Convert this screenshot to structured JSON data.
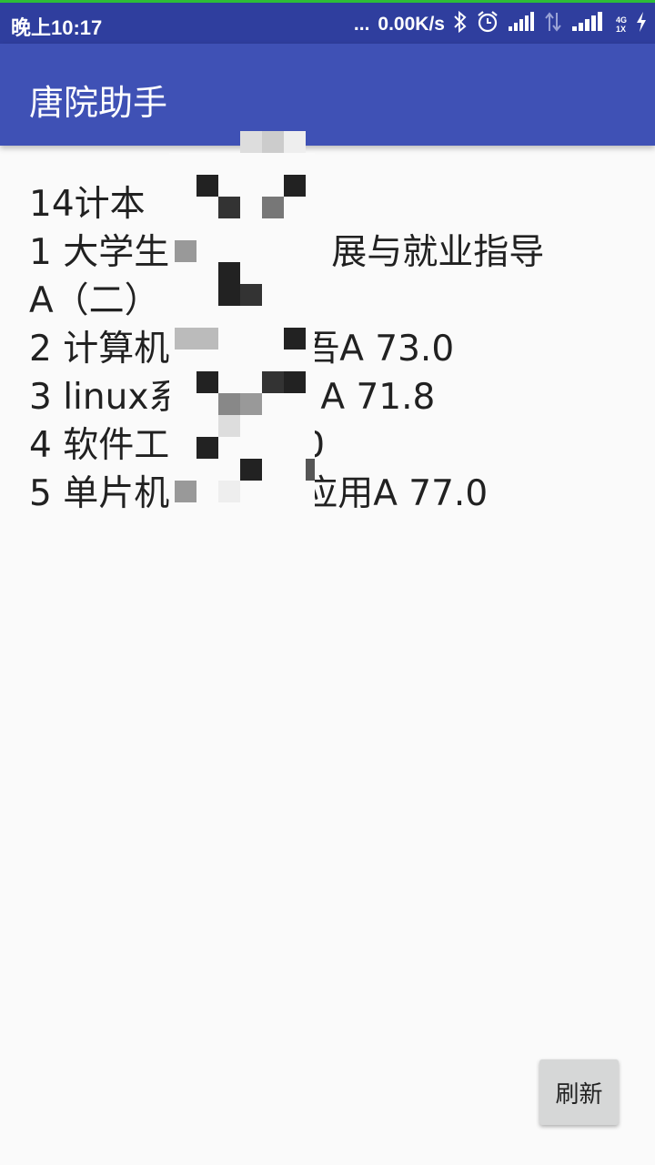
{
  "status_bar": {
    "time": "晚上10:17",
    "dots": "...",
    "net_speed": "0.00K/s",
    "icons": [
      "bluetooth-icon",
      "alarm-icon",
      "signal-icon",
      "data-transfer-icon",
      "signal-4g-icon",
      "charging-icon"
    ],
    "network_type": "4G",
    "sim_slot": "1X"
  },
  "app_bar": {
    "title": "唐院助手",
    "background": "#3f51b5"
  },
  "content": {
    "lines": [
      "14计本",
      "1 大学生",
      "A（二）",
      "2 计算机",
      "3 linux系",
      "4 软件工",
      "5 单片机"
    ],
    "line_tails": [
      "",
      "展与就业指导",
      "",
      "吾A 73.0",
      "A 71.8",
      "0",
      "应用A 77.0"
    ]
  },
  "actions": {
    "refresh_label": "刷新"
  },
  "colors": {
    "status_bar": "#2f3e9e",
    "app_bar": "#3f51b5",
    "background": "#fafafa",
    "button": "#d6d7d7"
  }
}
